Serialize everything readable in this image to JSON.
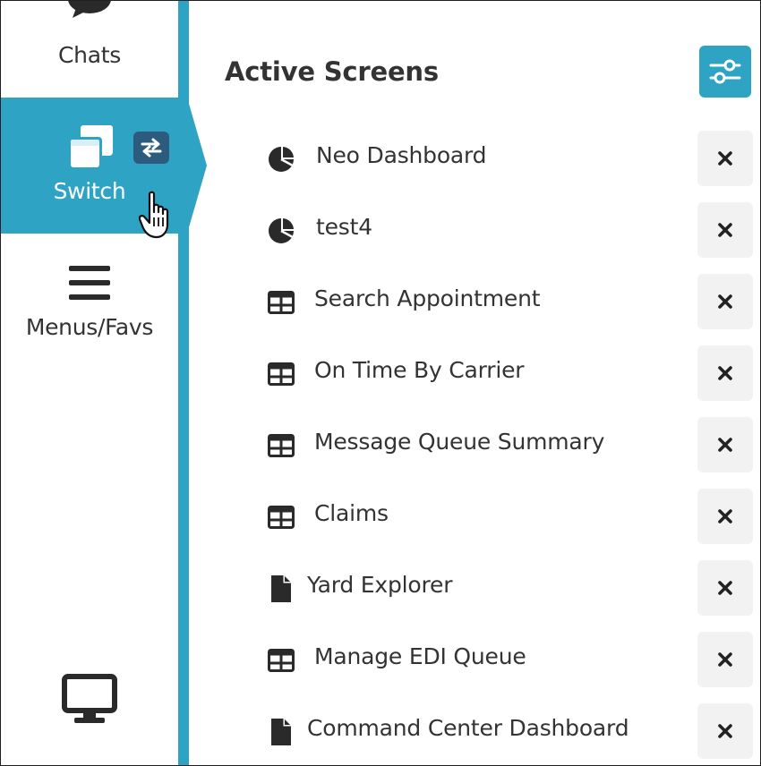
{
  "nav": {
    "chats": {
      "label": "Chats",
      "icon": "chat-bubble-icon"
    },
    "switch": {
      "label": "Switch",
      "icon": "windows-icon",
      "badge_icon": "swap-arrows-icon"
    },
    "menus": {
      "label": "Menus/Favs",
      "icon": "hamburger-icon"
    },
    "display": {
      "icon": "monitor-icon"
    }
  },
  "main": {
    "title": "Active Screens",
    "settings_icon": "sliders-icon",
    "screens": [
      {
        "label": "Neo Dashboard",
        "icon": "pie-chart-icon"
      },
      {
        "label": "test4",
        "icon": "pie-chart-icon"
      },
      {
        "label": "Search Appointment",
        "icon": "table-icon"
      },
      {
        "label": "On Time By Carrier",
        "icon": "table-icon"
      },
      {
        "label": "Message Queue Summary",
        "icon": "table-icon"
      },
      {
        "label": "Claims",
        "icon": "table-icon"
      },
      {
        "label": "Yard Explorer",
        "icon": "document-icon"
      },
      {
        "label": "Manage EDI Queue",
        "icon": "table-icon"
      },
      {
        "label": "Command Center Dashboard",
        "icon": "document-icon"
      }
    ],
    "close_icon": "close-icon"
  },
  "colors": {
    "accent": "#2ea3c4",
    "badge": "#2c5b7d",
    "text": "#333333",
    "close_bg": "#f2f2f2"
  }
}
